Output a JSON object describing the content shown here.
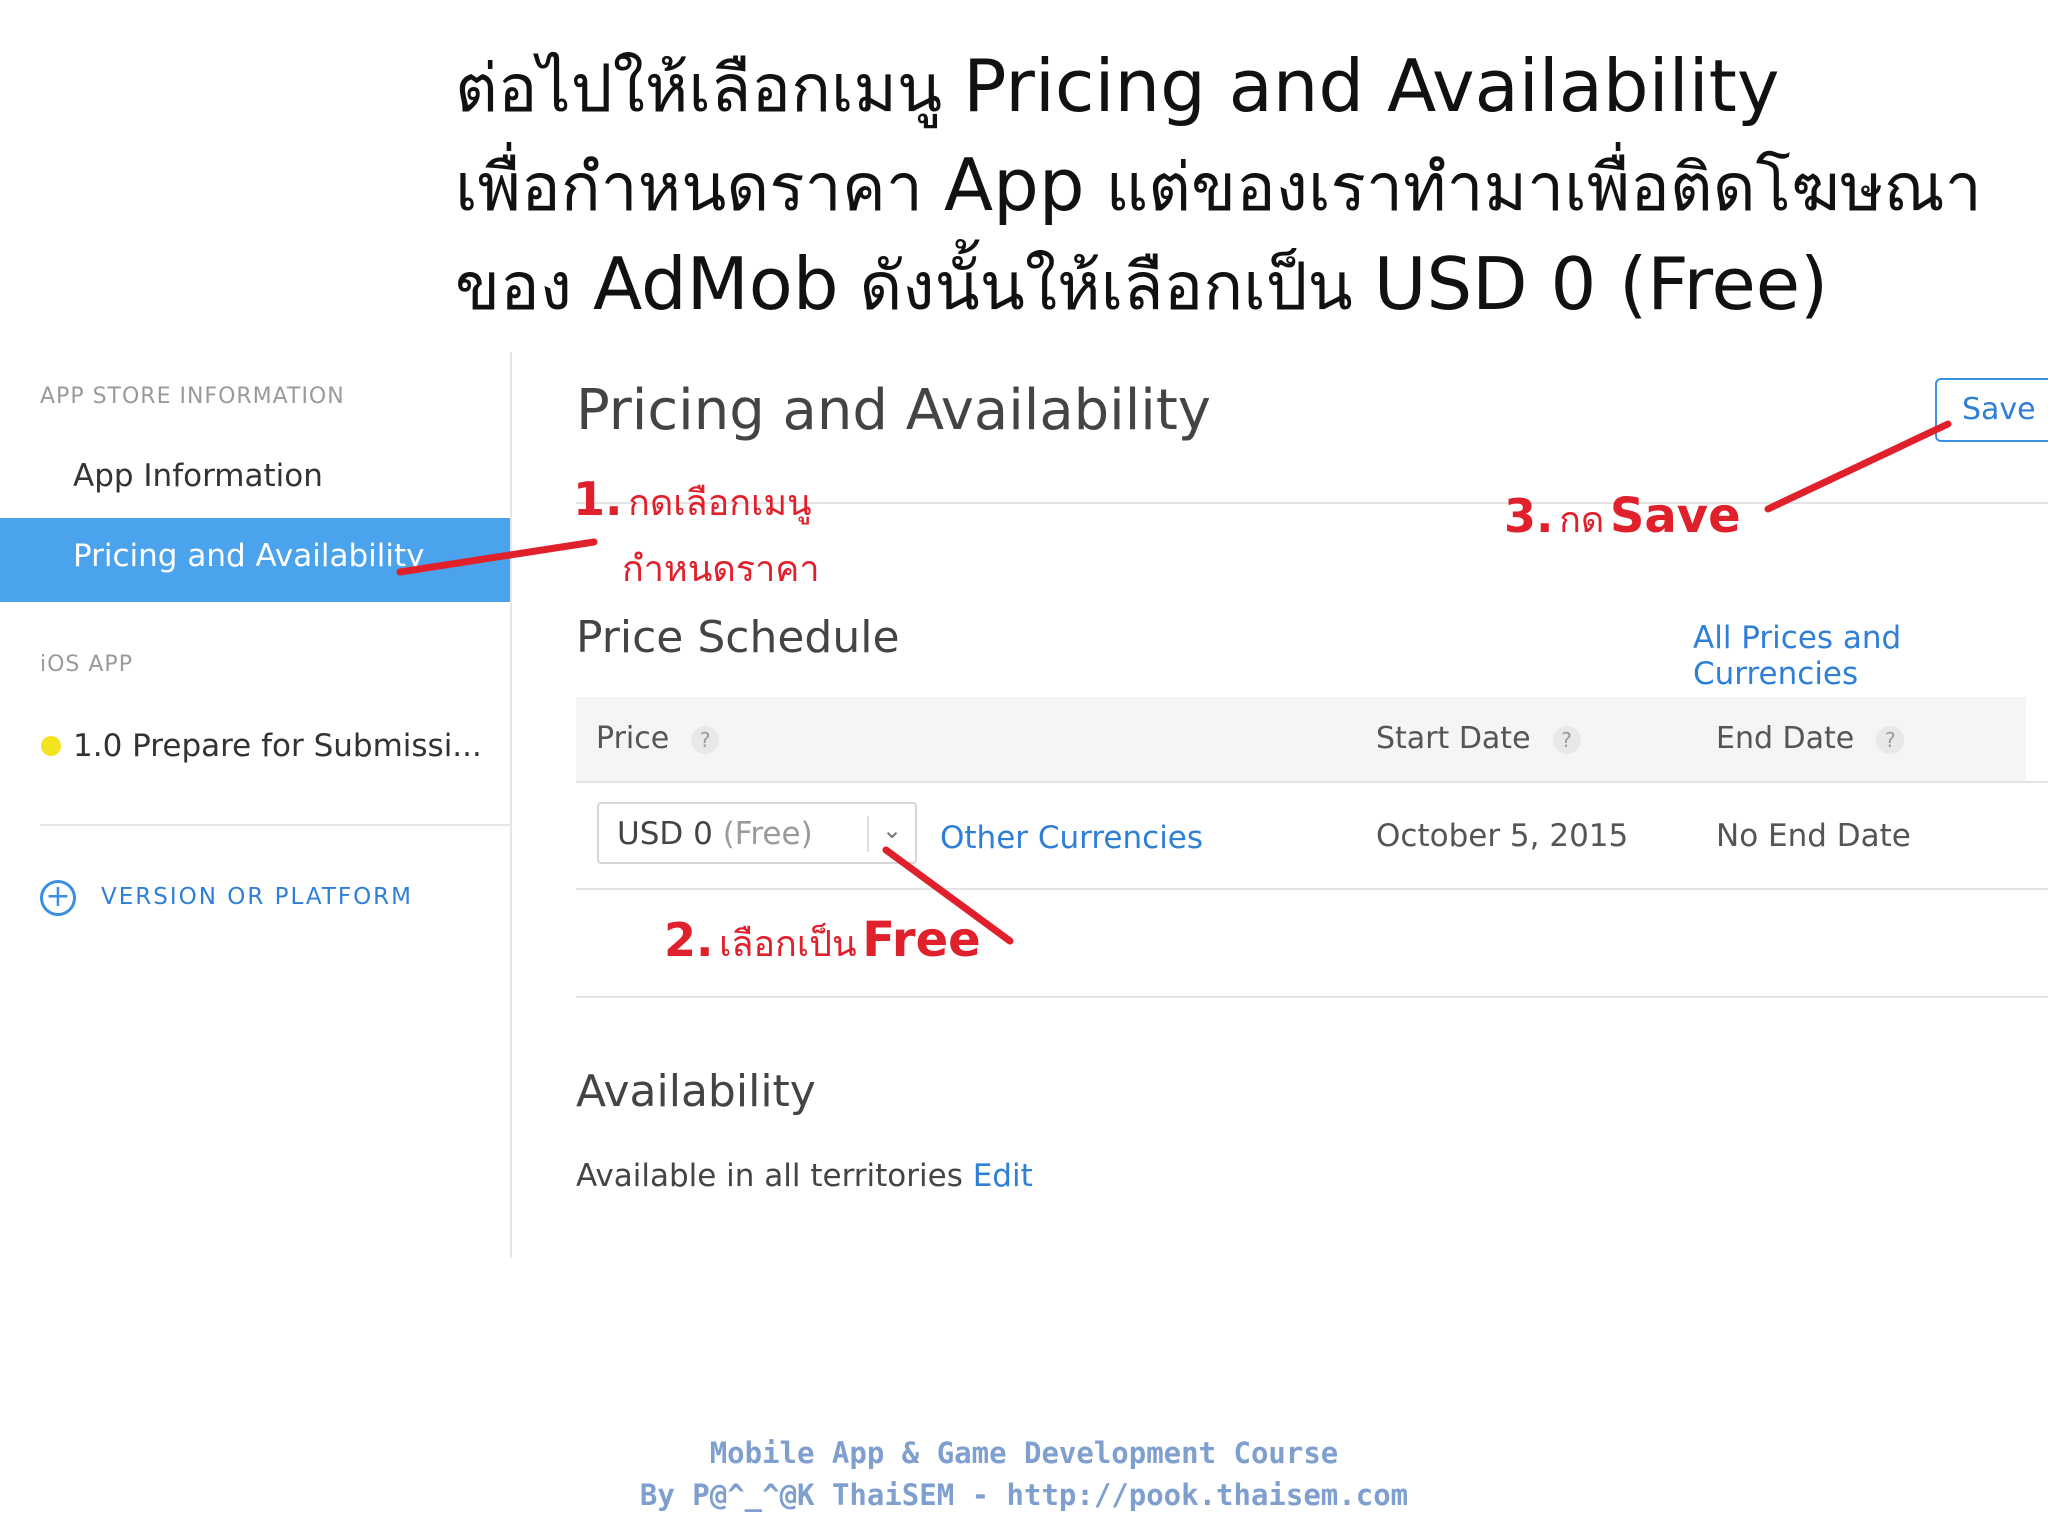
{
  "slide": {
    "line1_thai": "ต่อไปให้เลือกเมนู",
    "line1_en": "Pricing and Availability",
    "line2_thai": "เพื่อกำหนดราคา",
    "line2_en": "App",
    "line2_thai_b": "แต่ของเราทำมาเพื่อติดโฆษณา",
    "line3_thai": "ของ",
    "line3_en": "AdMob",
    "line3_thai_b": "ดังนั้นให้เลือกเป็น",
    "line3_en_b": "USD 0 (Free)"
  },
  "sidebar": {
    "section_app_store": "APP STORE INFORMATION",
    "items": [
      {
        "label": "App Information"
      },
      {
        "label": "Pricing and Availability"
      }
    ],
    "section_ios": "iOS APP",
    "version_item": "1.0 Prepare for Submissi...",
    "add_version": "VERSION OR PLATFORM",
    "add_icon": "plus-circle-icon"
  },
  "main": {
    "title": "Pricing and Availability",
    "save_label": "Save",
    "price_schedule_title": "Price Schedule",
    "all_prices_link": "All Prices and Currencies",
    "table": {
      "headers": [
        "Price",
        "Start Date",
        "End Date"
      ],
      "help_glyph": "?",
      "row": {
        "price_value": "USD 0",
        "price_note": "(Free)",
        "other_currencies": "Other Currencies",
        "start_date": "October 5, 2015",
        "end_date": "No End Date"
      }
    },
    "availability_title": "Availability",
    "availability_text": "Available in all territories",
    "availability_edit": "Edit"
  },
  "annotations": {
    "step1_num": "1.",
    "step1_line1": "กดเลือกเมนู",
    "step1_line2": "กำหนดราคา",
    "step2_num": "2.",
    "step2_text": "เลือกเป็น",
    "step2_word": "Free",
    "step3_num": "3.",
    "step3_text": "กด",
    "step3_word": "Save",
    "color": "#e0202b"
  },
  "footer": {
    "line1": "Mobile App & Game Development Course",
    "line2": "By P@^_^@K ThaiSEM - http://pook.thaisem.com"
  }
}
